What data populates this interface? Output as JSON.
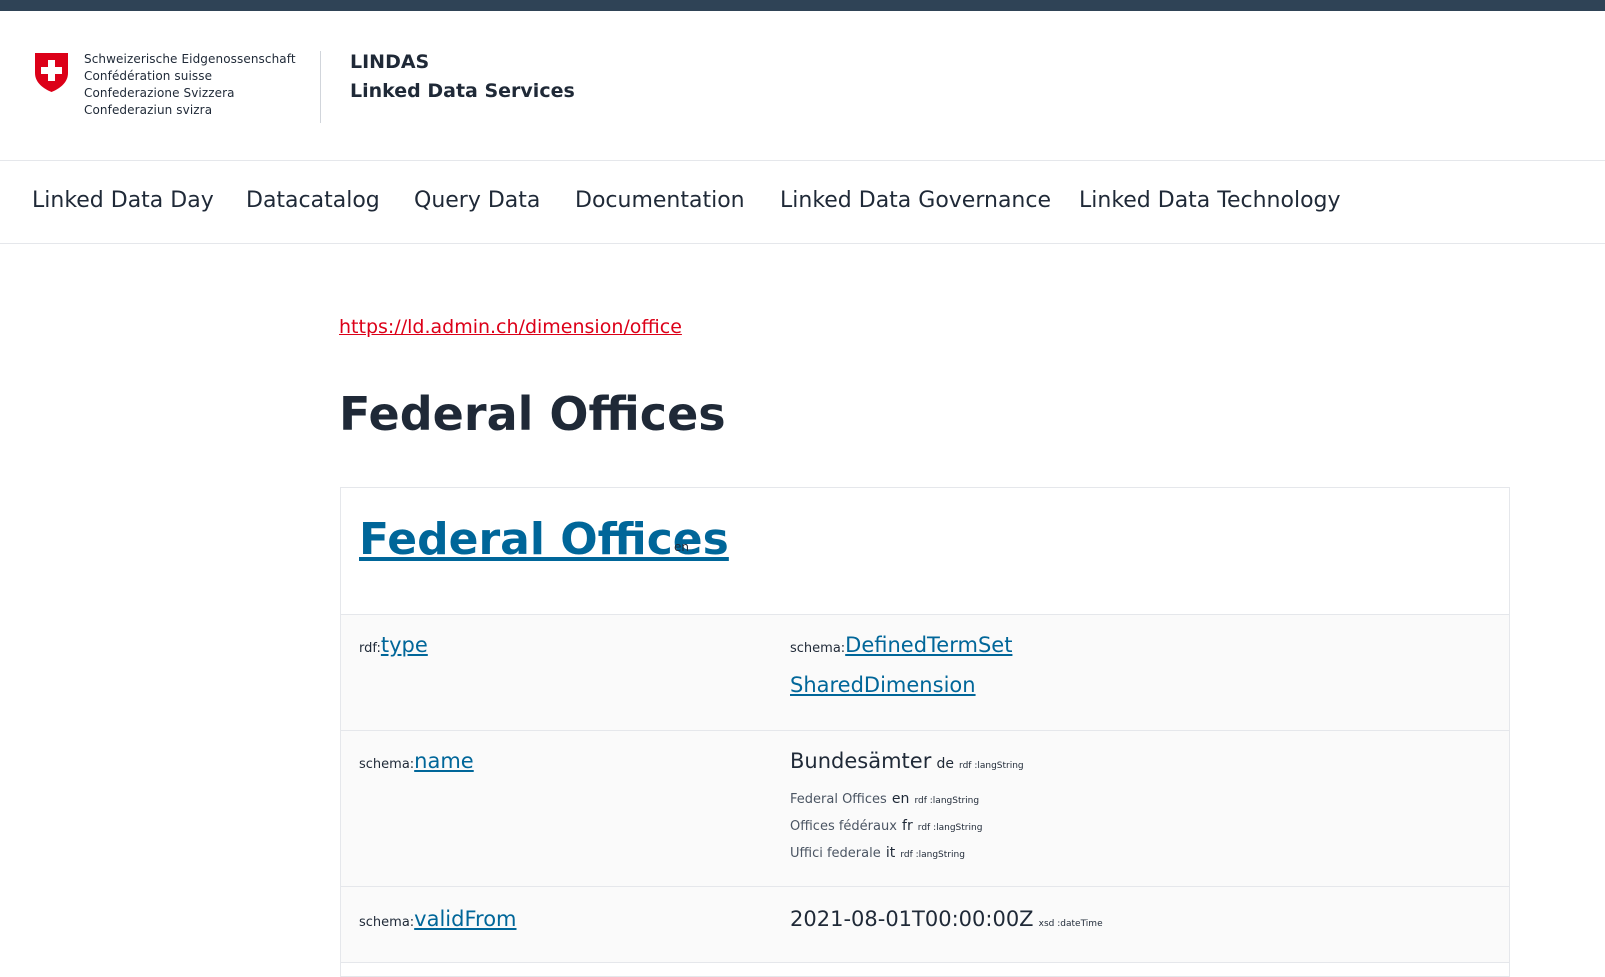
{
  "header": {
    "confederation_lines": [
      "Schweizerische Eidgenossenschaft",
      "Confédération suisse",
      "Confederazione Svizzera",
      "Confederaziun svizra"
    ],
    "site_title_line1": "LINDAS",
    "site_title_line2": "Linked Data Services"
  },
  "nav": {
    "items": [
      "Linked Data Day",
      "Datacatalog",
      "Query Data",
      "Documentation",
      "Linked Data Governance",
      "Linked Data Technology"
    ]
  },
  "resource": {
    "iri": "https://ld.admin.ch/dimension/office",
    "page_title": "Federal Offices",
    "label": "Federal Offices",
    "label_lang": "en"
  },
  "rows": [
    {
      "prefix": "rdf:",
      "local": "type",
      "objects": [
        {
          "prefix": "schema:",
          "local": "DefinedTermSet"
        },
        {
          "prefix": "",
          "local": "SharedDimension"
        }
      ]
    },
    {
      "prefix": "schema:",
      "local": "name",
      "literals": [
        {
          "value": "Bundesämter",
          "lang": "de",
          "datatype": "rdf :langString"
        },
        {
          "value": "Federal Offices",
          "lang": "en",
          "datatype": "rdf :langString"
        },
        {
          "value": "Offices fédéraux",
          "lang": "fr",
          "datatype": "rdf :langString"
        },
        {
          "value": "Uffici federale",
          "lang": "it",
          "datatype": "rdf :langString"
        }
      ]
    },
    {
      "prefix": "schema:",
      "local": "validFrom",
      "literal": {
        "value": "2021-08-01T00:00:00Z",
        "datatype": "xsd :dateTime"
      }
    }
  ],
  "colors": {
    "top_bar": "#2f4356",
    "link_blue": "#006699",
    "link_red": "#dc0018",
    "text": "#1f2937"
  }
}
